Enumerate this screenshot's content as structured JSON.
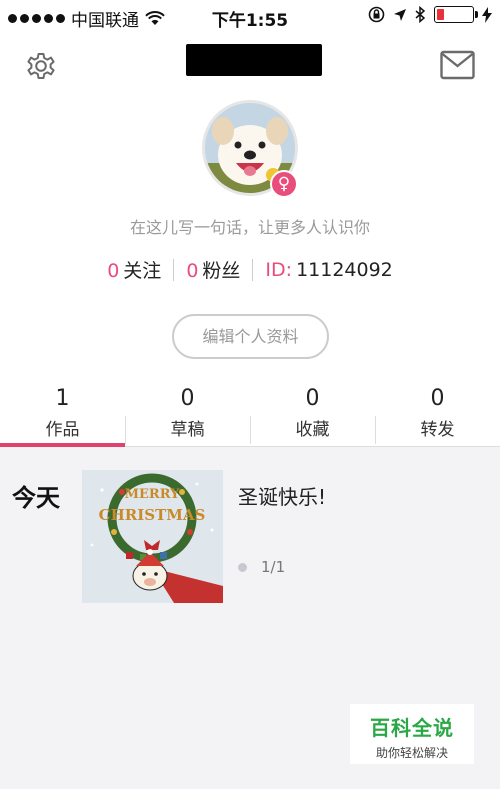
{
  "status": {
    "carrier": "中国联通",
    "time": "下午1:55",
    "battery_level": 0.2
  },
  "profile": {
    "bio": "在这儿写一句话，让更多人认识你",
    "following_count": "0",
    "following_label": "关注",
    "followers_count": "0",
    "followers_label": "粉丝",
    "id_label": "ID:",
    "id_value": "11124092",
    "edit_label": "编辑个人资料",
    "gender": "♀"
  },
  "tabs": [
    {
      "count": "1",
      "label": "作品",
      "active": true
    },
    {
      "count": "0",
      "label": "草稿",
      "active": false
    },
    {
      "count": "0",
      "label": "收藏",
      "active": false
    },
    {
      "count": "0",
      "label": "转发",
      "active": false
    }
  ],
  "feed": {
    "day": "今天",
    "title": "圣诞快乐!",
    "pages": "1/1",
    "thumbnail_text_1": "MERRY",
    "thumbnail_text_2": "CHRISTMAS"
  },
  "watermark": {
    "line1": "百科全说",
    "line2": "助你轻松解决"
  },
  "colors": {
    "accent": "#e0426e",
    "pink": "#e94d7b",
    "watermark_green": "#2aa846"
  }
}
